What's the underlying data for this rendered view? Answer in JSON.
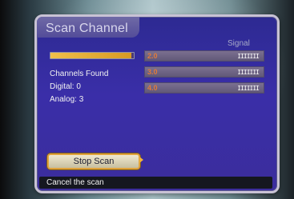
{
  "screen": {
    "title": "Scan Channel",
    "signal_header": "Signal"
  },
  "progress": {
    "fraction": 0.97
  },
  "stats": {
    "channels_found_label": "Channels Found",
    "digital_line": "Digital: 0",
    "analog_line": "Analog: 3"
  },
  "channels": [
    {
      "number": "2.0",
      "signal": "IIIIIII"
    },
    {
      "number": "3.0",
      "signal": "IIIIIII"
    },
    {
      "number": "4.0",
      "signal": "IIIIIII"
    }
  ],
  "actions": {
    "stop_scan_label": "Stop Scan"
  },
  "status": {
    "help_text": "Cancel the scan"
  },
  "colors": {
    "panel": "#3a2ea8",
    "accent": "#e0a33c",
    "channel_number": "#e07a3a"
  },
  "icons": {
    "focus_arrow": "triangle-right-icon"
  }
}
